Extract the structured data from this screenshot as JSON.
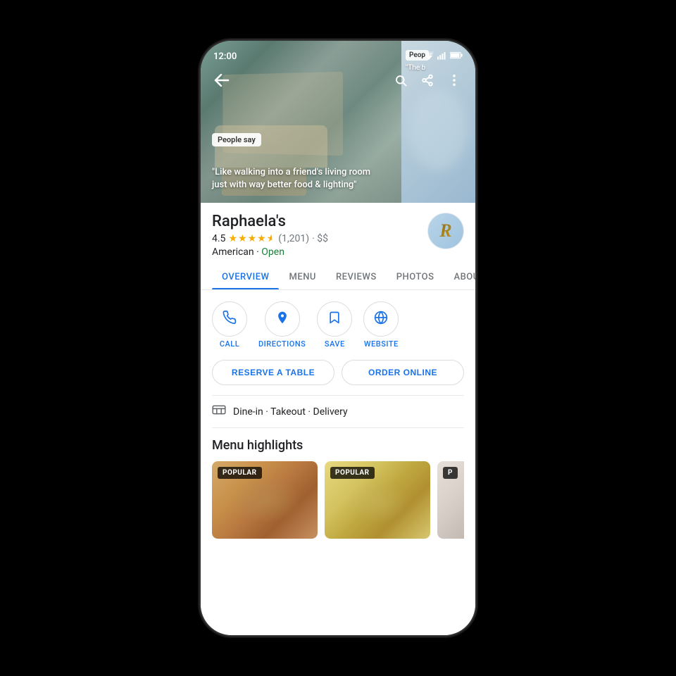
{
  "statusBar": {
    "time": "12:00"
  },
  "heroSection": {
    "peoplesSayLabel": "People say",
    "quote": "\"Like walking into a friend's living room just with way better food & lighting\"",
    "rightPanelBadge": "Peop",
    "rightPanelText": "\"The b"
  },
  "place": {
    "name": "Raphaela's",
    "rating": "4.5",
    "reviewCount": "(1,201)",
    "priceLevel": "$$",
    "cuisine": "American",
    "openStatus": "Open",
    "logoLetter": "R"
  },
  "tabs": [
    {
      "id": "overview",
      "label": "OVERVIEW",
      "active": true
    },
    {
      "id": "menu",
      "label": "MENU",
      "active": false
    },
    {
      "id": "reviews",
      "label": "REVIEWS",
      "active": false
    },
    {
      "id": "photos",
      "label": "PHOTOS",
      "active": false
    },
    {
      "id": "about",
      "label": "ABOU",
      "active": false
    }
  ],
  "actions": [
    {
      "id": "call",
      "label": "CALL"
    },
    {
      "id": "directions",
      "label": "DIRECTIONS"
    },
    {
      "id": "save",
      "label": "SAVE"
    },
    {
      "id": "website",
      "label": "WEBSITE"
    }
  ],
  "ctaButtons": [
    {
      "id": "reserve",
      "label": "RESERVE A TABLE"
    },
    {
      "id": "order",
      "label": "ORDER ONLINE"
    }
  ],
  "serviceInfo": {
    "text": "Dine-in · Takeout · Delivery"
  },
  "menuHighlights": {
    "title": "Menu highlights",
    "items": [
      {
        "id": "item1",
        "badge": "POPULAR"
      },
      {
        "id": "item2",
        "badge": "POPULAR"
      },
      {
        "id": "item3",
        "badge": "P"
      }
    ]
  }
}
